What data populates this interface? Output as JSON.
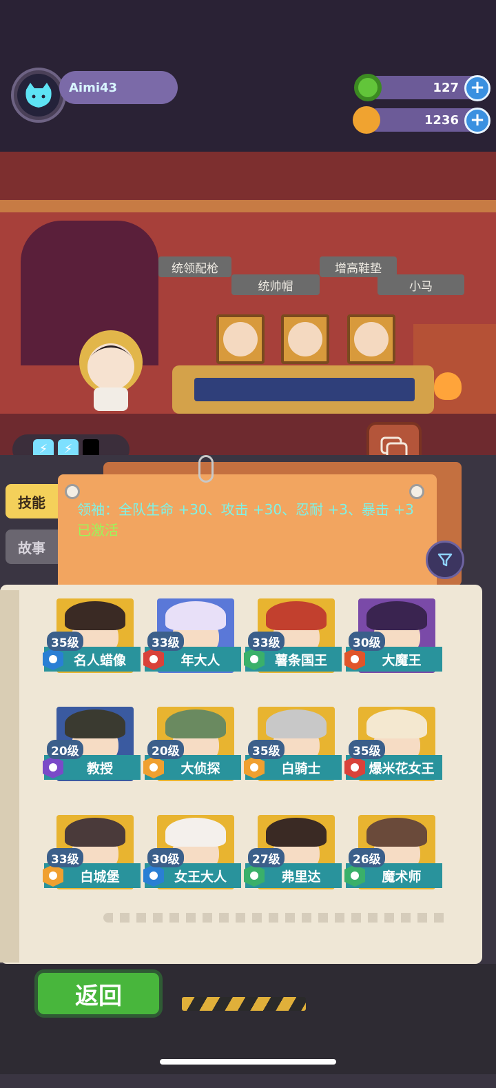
{
  "player": {
    "name": "Aimi43"
  },
  "currencies": [
    {
      "name": "donut",
      "value": "127",
      "color": "#62c53a"
    },
    {
      "name": "planet-coin",
      "value": "1236",
      "color": "#f0a330"
    }
  ],
  "scene": {
    "items": [
      "统领配枪",
      "统帅帽",
      "增高鞋垫",
      "小马"
    ]
  },
  "tabs": {
    "skill": "技能",
    "story": "故事"
  },
  "skill": {
    "description": "领袖：全队生命 +30、攻击 +30、忍耐 +3、暴击 +3",
    "status": "已激活"
  },
  "characters": [
    {
      "level": "35级",
      "name": "名人蜡像",
      "rank_color": "#2a7fd4",
      "hair": "#3a2a24",
      "art": "#e8b430"
    },
    {
      "level": "33级",
      "name": "年大人",
      "rank_color": "#d9423a",
      "hair": "#e8e0f8",
      "art": "#5a78d8"
    },
    {
      "level": "33级",
      "name": "薯条国王",
      "rank_color": "#3ab06a",
      "hair": "#c2402e",
      "art": "#e8b430"
    },
    {
      "level": "30级",
      "name": "大魔王",
      "rank_color": "#e0552a",
      "hair": "#3a2450",
      "art": "#7a4aa8"
    },
    {
      "level": "20级",
      "name": "教授",
      "rank_color": "#7a4ac8",
      "hair": "#3a3a30",
      "art": "#3a5aa0"
    },
    {
      "level": "20级",
      "name": "大侦探",
      "rank_color": "#f0a030",
      "hair": "#6a8a60",
      "art": "#e8b430"
    },
    {
      "level": "35级",
      "name": "白骑士",
      "rank_color": "#f0a030",
      "hair": "#c8c8c8",
      "art": "#e8b430"
    },
    {
      "level": "35级",
      "name": "爆米花女王",
      "rank_color": "#d9423a",
      "hair": "#f4e8d0",
      "art": "#e8b430"
    },
    {
      "level": "33级",
      "name": "白城堡",
      "rank_color": "#f0a030",
      "hair": "#4a3a3a",
      "art": "#e8b430"
    },
    {
      "level": "30级",
      "name": "女王大人",
      "rank_color": "#2a7fd4",
      "hair": "#f4f0ec",
      "art": "#e8b430"
    },
    {
      "level": "27级",
      "name": "弗里达",
      "rank_color": "#3ab06a",
      "hair": "#3a2a24",
      "art": "#e8b430"
    },
    {
      "level": "26级",
      "name": "魔术师",
      "rank_color": "#3ab06a",
      "hair": "#6a4a3a",
      "art": "#e8b430"
    }
  ],
  "footer": {
    "back_label": "返回"
  },
  "icons": {
    "avatar": "cat-icon",
    "energy": "lightning-icon",
    "chat": "chat-icon",
    "filter": "filter-icon",
    "add": "plus-icon"
  }
}
